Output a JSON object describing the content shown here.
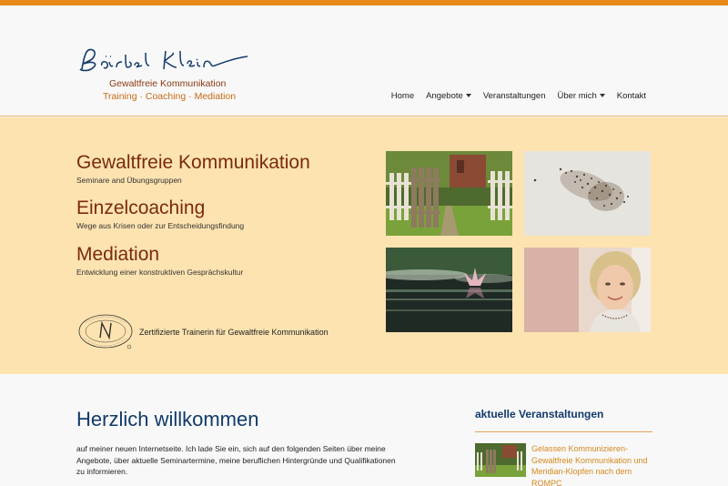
{
  "brand": {
    "signature_name": "Bärbel Klein",
    "tagline_line1": "Gewaltfreie Kommunikation",
    "tagline_line2": "Training · Coaching · Mediation"
  },
  "nav": {
    "items": [
      {
        "label": "Home",
        "has_dropdown": false
      },
      {
        "label": "Angebote",
        "has_dropdown": true
      },
      {
        "label": "Veranstaltungen",
        "has_dropdown": false
      },
      {
        "label": "Über mich",
        "has_dropdown": true
      },
      {
        "label": "Kontakt",
        "has_dropdown": false
      }
    ]
  },
  "services": [
    {
      "title": "Gewaltfreie Kommunikation",
      "subtitle": "Seminare and Übungsgruppen"
    },
    {
      "title": "Einzelcoaching",
      "subtitle": "Wege aus Krisen oder zur Entscheidungsfindung"
    },
    {
      "title": "Mediation",
      "subtitle": "Entwicklung einer konstruktiven Gesprächskultur"
    }
  ],
  "certification": {
    "seal_text": "THE CENTER FOR NONVIOLENT COMMUNICATION",
    "text": "Zertifizierte Trainerin für Gewaltfreie Kommunikation"
  },
  "welcome": {
    "title": "Herzlich willkommen",
    "text": "auf meiner neuen Internetseite. Ich lade Sie ein, sich auf den folgenden Seiten über meine Angebote, über aktuelle Seminartermine, meine beruflichen Hintergründe und Qualifikationen zu informieren."
  },
  "events": {
    "title": "aktuelle Veranstaltungen",
    "items": [
      {
        "text": "Gelassen Kommunizieren- Gewaltfreie Kommunikation und Meridian-Klopfen nach dem ROMPC"
      }
    ]
  },
  "colors": {
    "accent_orange": "#e8891a",
    "hero_bg": "#fde3b0",
    "service_title": "#7a2a0e",
    "heading_blue": "#123a6a",
    "event_link": "#d4891e"
  }
}
